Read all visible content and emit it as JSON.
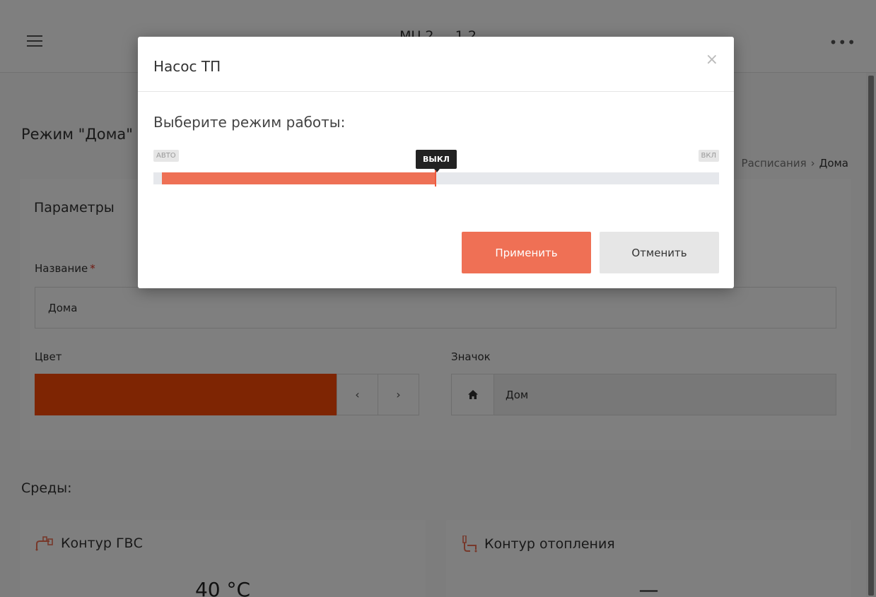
{
  "app": {
    "title": "MU 2 ... 1 2"
  },
  "page": {
    "title": "Режим \"Дома\"",
    "breadcrumb": [
      "Расписания",
      "Дома"
    ]
  },
  "params": {
    "title": "Параметры",
    "name_label": "Название",
    "name_required_mark": "*",
    "name_value": "Дома",
    "color_label": "Цвет",
    "color_value": "#fc4a07",
    "prev_label": "‹",
    "next_label": "›",
    "icon_label": "Значок",
    "icon_value": "Дом",
    "icon_name": "home-icon"
  },
  "environments": {
    "title": "Среды:",
    "cards": [
      {
        "title": "Контур ГВС",
        "icon": "tap-icon",
        "value": "40 °C"
      },
      {
        "title": "Контур отопления",
        "icon": "radiator-tap-icon",
        "value": "—"
      }
    ]
  },
  "modal": {
    "title": "Насос ТП",
    "close_label": "×",
    "prompt": "Выберите режим работы:",
    "slider": {
      "min_label": "АВТО",
      "current_label": "ВЫКЛ",
      "max_label": "ВКЛ",
      "options": [
        "АВТО",
        "ВЫКЛ",
        "ВКЛ"
      ],
      "current_index": 1,
      "position_fraction": 0.5
    },
    "apply_label": "Применить",
    "cancel_label": "Отменить"
  },
  "colors": {
    "accent": "#ef7055",
    "swatch": "#fc4a07",
    "overlay": "rgba(0,0,0,0.5)"
  }
}
